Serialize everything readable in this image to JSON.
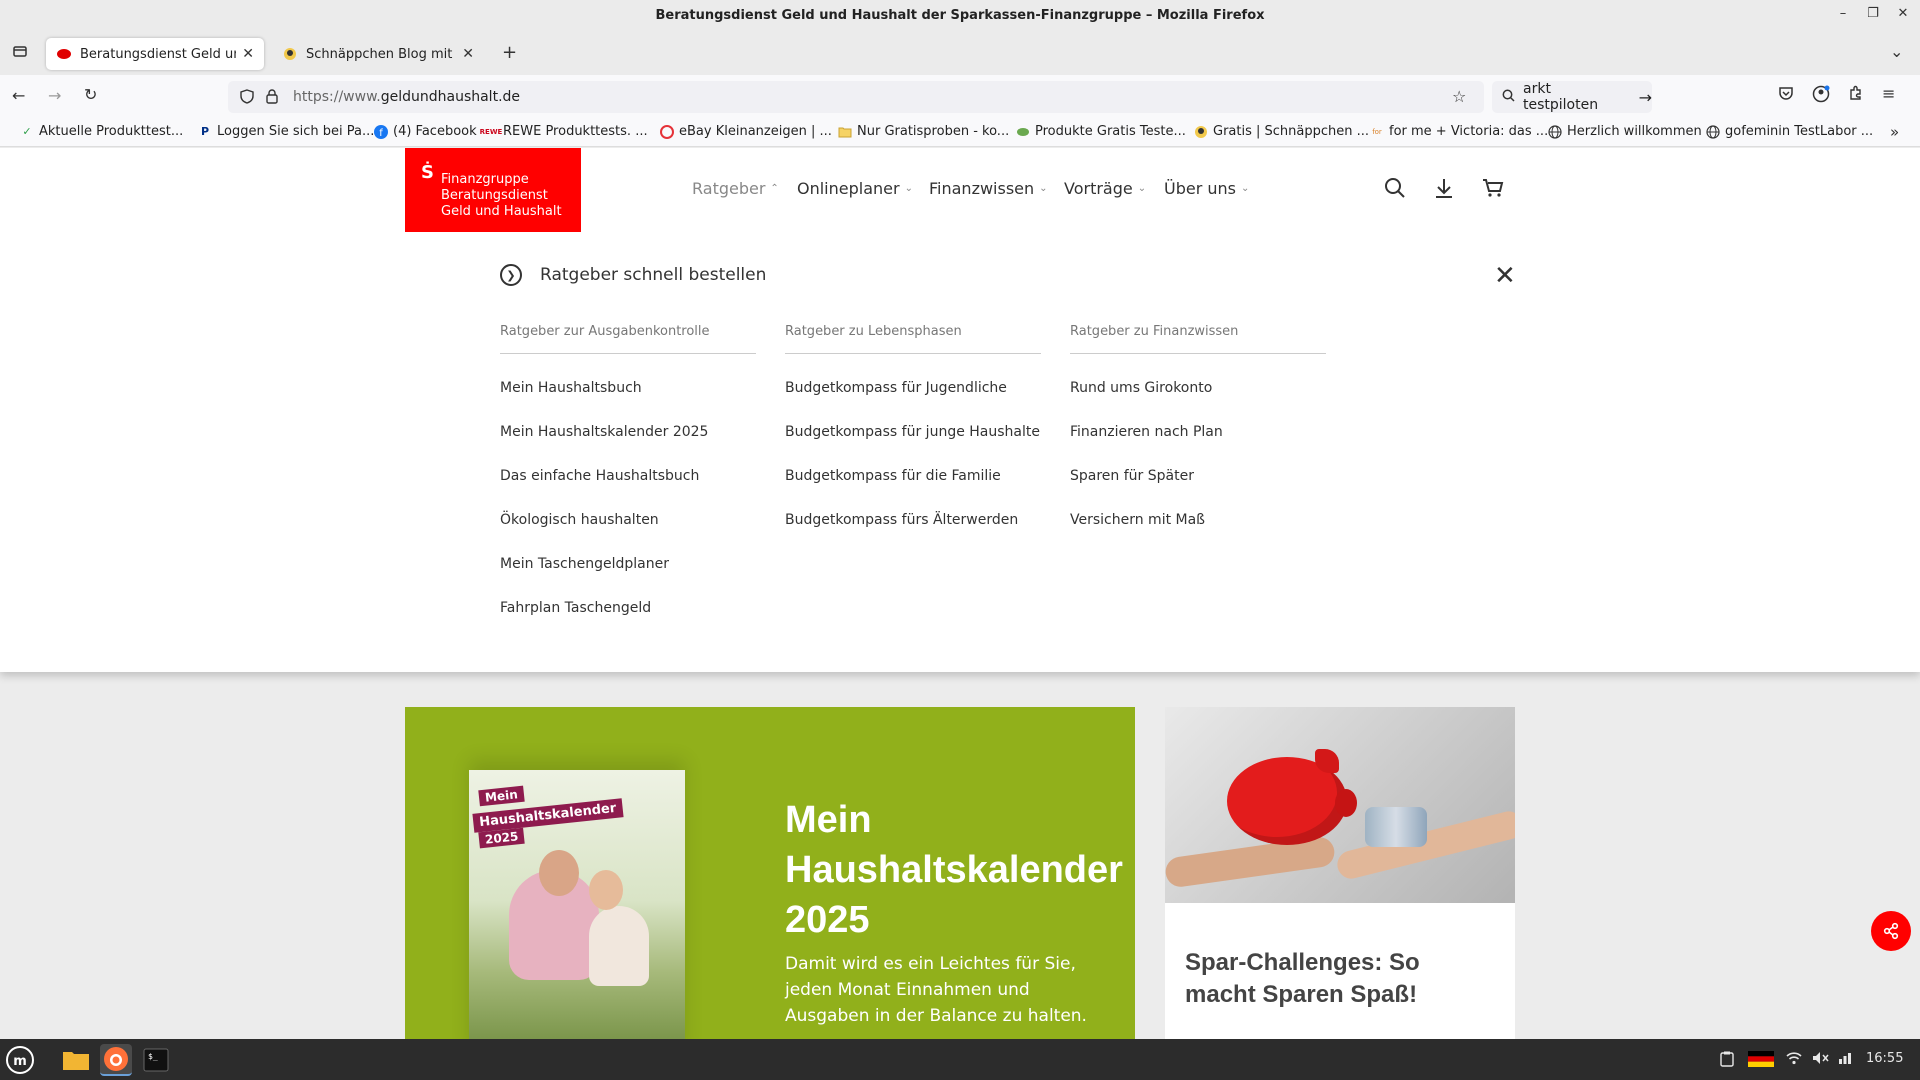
{
  "window": {
    "title": "Beratungsdienst Geld und Haushalt der Sparkassen-Finanzgruppe – Mozilla Firefox",
    "controls": [
      "–",
      "❐",
      "✕"
    ]
  },
  "tabs": [
    {
      "label": "Beratungsdienst Geld und Haushalt",
      "active": true,
      "close": "✕"
    },
    {
      "label": "Schnäppchen Blog mit Doktor",
      "active": false,
      "close": "✕"
    }
  ],
  "toolbar": {
    "url_prefix": "https://www.",
    "url_domain": "geldundhaushalt.de",
    "search_text": "arkt testpiloten"
  },
  "bookmarks": [
    "Aktuelle Produkttest...",
    "Loggen Sie sich bei Pa...",
    "(4) Facebook",
    "REWE Produkttests. ...",
    "eBay Kleinanzeigen | ...",
    "Nur Gratisproben - ko...",
    "Produkte Gratis Teste...",
    "Gratis | Schnäppchen ...",
    "for me + Victoria: das ...",
    "Herzlich willkommen",
    "gofeminin TestLabor ..."
  ],
  "site": {
    "logo": {
      "mark": "Ṡ",
      "line1": "Finanzgruppe",
      "line2": "Beratungsdienst",
      "line3": "Geld und Haushalt"
    },
    "nav": [
      "Ratgeber",
      "Onlineplaner",
      "Finanzwissen",
      "Vorträge",
      "Über uns"
    ],
    "mega_menu": {
      "title": "Ratgeber schnell bestellen",
      "columns": [
        {
          "heading": "Ratgeber zur Ausgabenkontrolle",
          "links": [
            "Mein Haushaltsbuch",
            "Mein Haushaltskalender 2025",
            "Das einfache Haushaltsbuch",
            "Ökologisch haushalten",
            "Mein Taschengeldplaner",
            "Fahrplan Taschengeld"
          ]
        },
        {
          "heading": "Ratgeber zu Lebensphasen",
          "links": [
            "Budgetkompass für Jugendliche",
            "Budgetkompass für junge Haushalte",
            "Budgetkompass für die Familie",
            "Budgetkompass fürs Älterwerden"
          ]
        },
        {
          "heading": "Ratgeber zu Finanzwissen",
          "links": [
            "Rund ums Girokonto",
            "Finanzieren nach Plan",
            "Sparen für Später",
            "Versichern mit Maß"
          ]
        }
      ]
    },
    "hero": {
      "book_line1": "Mein",
      "book_line2": "Haushaltskalender",
      "book_line3": "2025",
      "title": "Mein Haushaltskalender 2025",
      "description": "Damit wird es ein Leichtes für Sie, jeden Monat Einnahmen und Ausgaben in der Balance zu halten.",
      "background": "#91b01b"
    },
    "card": {
      "title": "Spar-Challenges: So macht Sparen Spaß!"
    },
    "brand_color": "#ff0000"
  },
  "taskbar": {
    "clock": "16:55"
  }
}
